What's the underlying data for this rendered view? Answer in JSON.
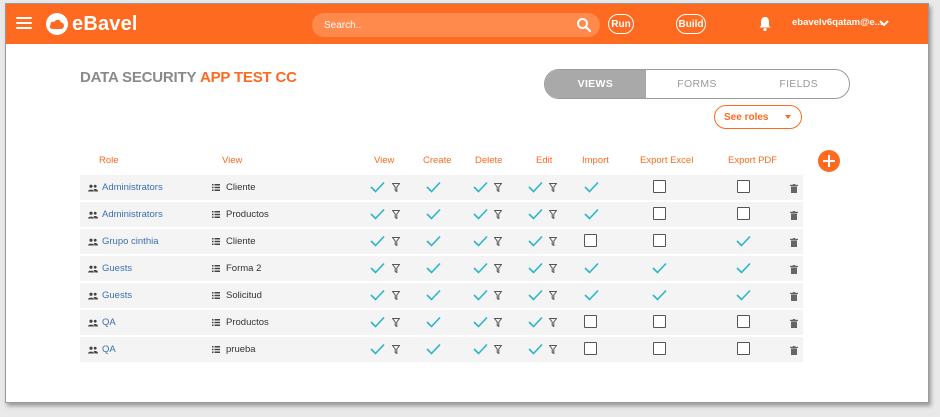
{
  "app": {
    "logo_text": "eBavel"
  },
  "topbar": {
    "search_placeholder": "Search..",
    "run_label": "Run",
    "build_label": "Build",
    "user_label": "ebavelv6qatam@e..."
  },
  "heading": {
    "title": "DATA SECURITY",
    "app_name": "APP TEST CC"
  },
  "tabs": [
    {
      "label": "VIEWS",
      "active": true
    },
    {
      "label": "FORMS",
      "active": false
    },
    {
      "label": "FIELDS",
      "active": false
    }
  ],
  "see_roles_label": "See roles",
  "columns": {
    "role": "Role",
    "view": "View",
    "view_perm": "View",
    "create": "Create",
    "delete": "Delete",
    "edit": "Edit",
    "import": "Import",
    "export_excel": "Export Excel",
    "export_pdf": "Export PDF"
  },
  "colors": {
    "accent": "#fe6a1f",
    "check": "#2bb5c9",
    "link": "#3a6fb0"
  },
  "rows": [
    {
      "role": "Administrators",
      "view": "Cliente",
      "perm_view": true,
      "create": true,
      "delete": true,
      "edit": true,
      "import": true,
      "export_excel": false,
      "export_pdf": false
    },
    {
      "role": "Administrators",
      "view": "Productos",
      "perm_view": true,
      "create": true,
      "delete": true,
      "edit": true,
      "import": true,
      "export_excel": false,
      "export_pdf": false
    },
    {
      "role": "Grupo cinthia",
      "view": "Cliente",
      "perm_view": true,
      "create": true,
      "delete": true,
      "edit": true,
      "import": false,
      "export_excel": false,
      "export_pdf": true
    },
    {
      "role": "Guests",
      "view": "Forma 2",
      "perm_view": true,
      "create": true,
      "delete": true,
      "edit": true,
      "import": true,
      "export_excel": true,
      "export_pdf": true
    },
    {
      "role": "Guests",
      "view": "Solicitud",
      "perm_view": true,
      "create": true,
      "delete": true,
      "edit": true,
      "import": true,
      "export_excel": true,
      "export_pdf": true
    },
    {
      "role": "QA",
      "view": "Productos",
      "perm_view": true,
      "create": true,
      "delete": true,
      "edit": true,
      "import": false,
      "export_excel": false,
      "export_pdf": false
    },
    {
      "role": "QA",
      "view": "prueba",
      "perm_view": true,
      "create": true,
      "delete": true,
      "edit": true,
      "import": false,
      "export_excel": false,
      "export_pdf": false
    }
  ]
}
